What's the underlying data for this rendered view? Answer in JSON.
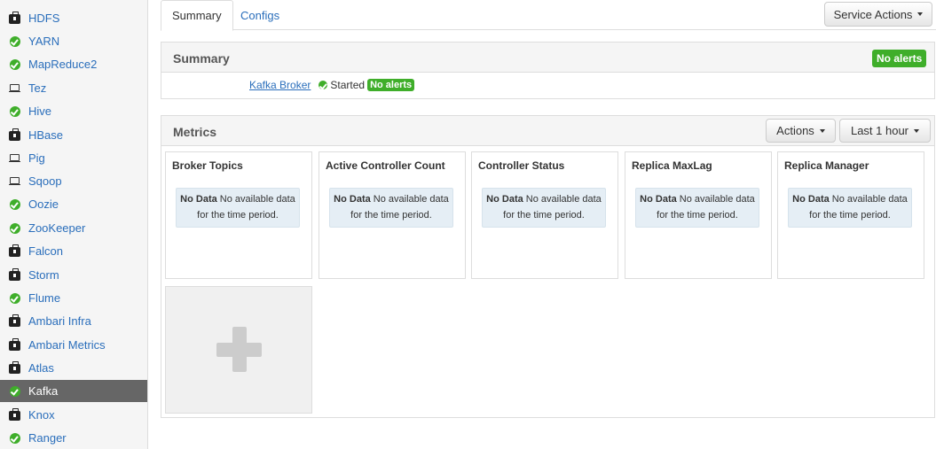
{
  "sidebar": {
    "items": [
      {
        "label": "HDFS",
        "icon": "briefcase-icon"
      },
      {
        "label": "YARN",
        "icon": "check-circle-icon"
      },
      {
        "label": "MapReduce2",
        "icon": "check-circle-icon"
      },
      {
        "label": "Tez",
        "icon": "laptop-icon"
      },
      {
        "label": "Hive",
        "icon": "check-circle-icon"
      },
      {
        "label": "HBase",
        "icon": "briefcase-icon"
      },
      {
        "label": "Pig",
        "icon": "laptop-icon"
      },
      {
        "label": "Sqoop",
        "icon": "laptop-icon"
      },
      {
        "label": "Oozie",
        "icon": "check-circle-icon"
      },
      {
        "label": "ZooKeeper",
        "icon": "check-circle-icon"
      },
      {
        "label": "Falcon",
        "icon": "briefcase-icon"
      },
      {
        "label": "Storm",
        "icon": "briefcase-icon"
      },
      {
        "label": "Flume",
        "icon": "check-circle-icon"
      },
      {
        "label": "Ambari Infra",
        "icon": "briefcase-icon"
      },
      {
        "label": "Ambari Metrics",
        "icon": "briefcase-icon"
      },
      {
        "label": "Atlas",
        "icon": "briefcase-icon"
      },
      {
        "label": "Kafka",
        "icon": "check-circle-icon",
        "active": true
      },
      {
        "label": "Knox",
        "icon": "briefcase-icon"
      },
      {
        "label": "Ranger",
        "icon": "check-circle-icon"
      }
    ]
  },
  "tabs": {
    "summary": "Summary",
    "configs": "Configs"
  },
  "service_actions": "Service Actions",
  "summary_panel": {
    "title": "Summary",
    "alerts_badge": "No alerts",
    "component_link": "Kafka Broker",
    "component_status": "Started",
    "component_alerts": "No alerts"
  },
  "metrics_panel": {
    "title": "Metrics",
    "actions_label": "Actions",
    "time_range_label": "Last 1 hour",
    "widgets": [
      {
        "title": "Broker Topics",
        "nodata_bold": "No Data",
        "nodata_text": "No available data for the time period."
      },
      {
        "title": "Active Controller Count",
        "nodata_bold": "No Data",
        "nodata_text": "No available data for the time period."
      },
      {
        "title": "Controller Status",
        "nodata_bold": "No Data",
        "nodata_text": "No available data for the time period."
      },
      {
        "title": "Replica MaxLag",
        "nodata_bold": "No Data",
        "nodata_text": "No available data for the time period."
      },
      {
        "title": "Replica Manager",
        "nodata_bold": "No Data",
        "nodata_text": "No available data for the time period."
      }
    ]
  },
  "colors": {
    "status_green": "#3fae2a",
    "link_blue": "#2a6ebb",
    "active_bg": "#666666"
  }
}
